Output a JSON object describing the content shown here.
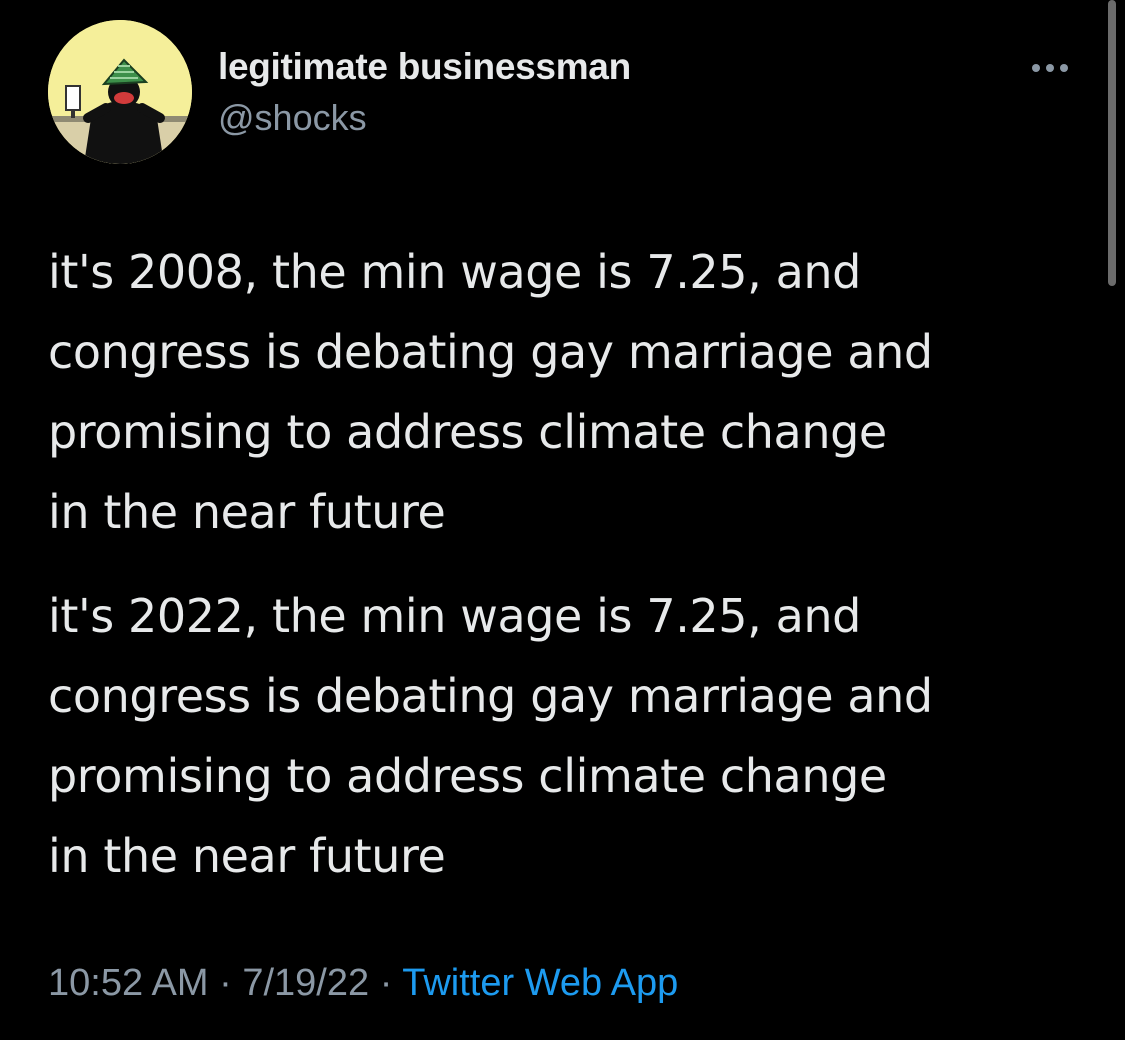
{
  "user": {
    "display_name": "legitimate businessman",
    "handle": "@shocks",
    "avatar_icon": "cartoon-figure-avatar"
  },
  "more_icon": "more-horizontal-icon",
  "tweet": {
    "paragraphs": [
      "it's 2008, the min wage is 7.25, and\ncongress is debating gay marriage and\npromising to address climate change\nin the near future",
      "it's 2022, the min wage is 7.25, and\ncongress is debating gay marriage and\npromising to address climate change\nin the near future"
    ]
  },
  "meta": {
    "time": "10:52 AM",
    "separator": "·",
    "date": "7/19/22",
    "source": "Twitter Web App"
  },
  "colors": {
    "background": "#000000",
    "text_primary": "#e7e9ea",
    "text_secondary": "#8b98a5",
    "link": "#1d9bf0"
  }
}
